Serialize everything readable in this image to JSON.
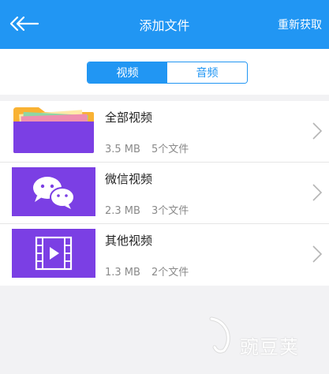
{
  "header": {
    "title": "添加文件",
    "action_label": "重新获取"
  },
  "tabs": [
    {
      "label": "视频",
      "active": true
    },
    {
      "label": "音频",
      "active": false
    }
  ],
  "items": [
    {
      "title": "全部视频",
      "size": "3.5 MB",
      "count": "5个文件",
      "icon": "folder-icon"
    },
    {
      "title": "微信视频",
      "size": "2.3 MB",
      "count": "3个文件",
      "icon": "wechat-icon"
    },
    {
      "title": "其他视频",
      "size": "1.3 MB",
      "count": "2个文件",
      "icon": "film-play-icon"
    }
  ],
  "watermark": {
    "text": "豌豆荚"
  },
  "colors": {
    "primary": "#2196f3",
    "thumb_purple": "#7b3fe4",
    "folder_yellow": "#f9b233"
  }
}
